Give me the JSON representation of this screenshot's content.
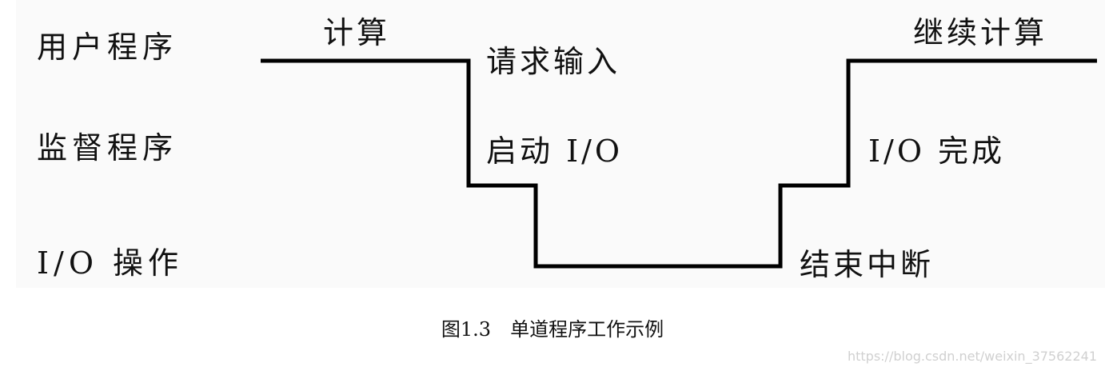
{
  "rows": {
    "user": "用户程序",
    "monitor": "监督程序",
    "io": "I/O 操作"
  },
  "annotations": {
    "compute": "计算",
    "request_input": "请求输入",
    "start_io": "启动 I/O",
    "end_interrupt": "结束中断",
    "io_complete": "I/O 完成",
    "continue_compute": "继续计算"
  },
  "caption": "图1.3　单道程序工作示例",
  "watermark": "https://blog.csdn.net/weixin_37562241",
  "colors": {
    "line": "#000000",
    "text": "#111111",
    "panel": "#fafafa",
    "watermark": "#d0d0d0"
  }
}
